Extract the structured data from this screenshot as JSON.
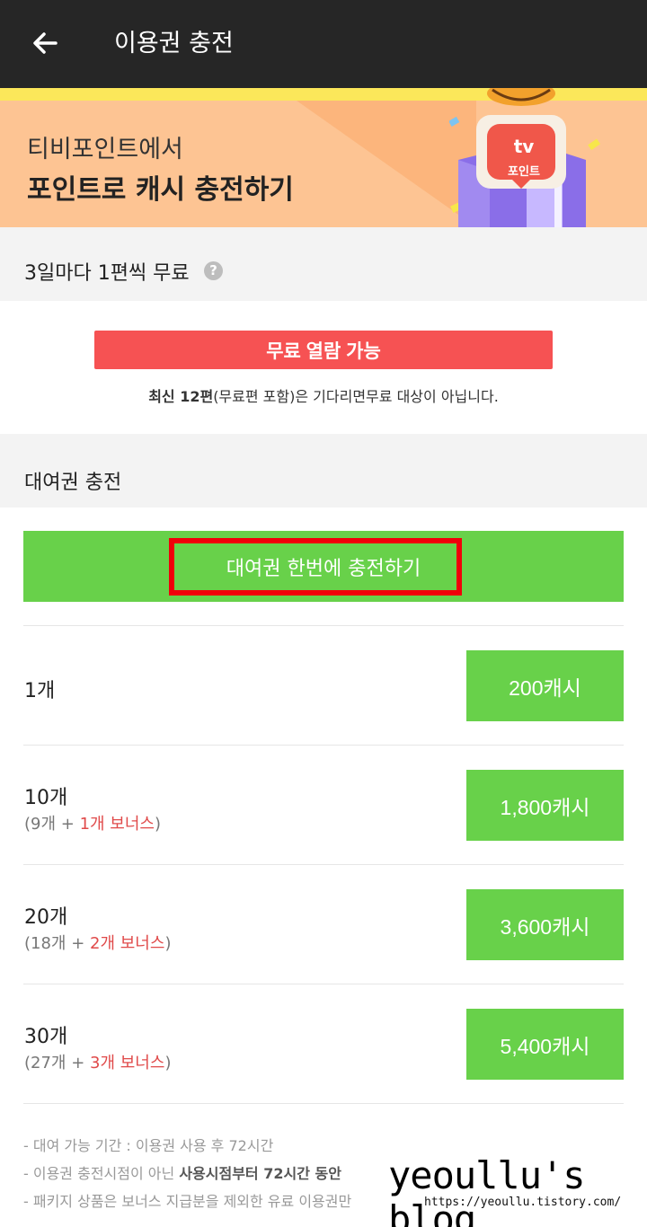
{
  "header": {
    "title": "이용권 충전",
    "back_icon": "arrow-left-icon"
  },
  "banner": {
    "subtitle": "티비포인트에서",
    "title": "포인트로 캐시 충전하기",
    "badge_tv": "tv",
    "badge_label": "포인트"
  },
  "free_section": {
    "title": "3일마다 1편씩 무료",
    "help_icon": "?",
    "button_label": "무료 열람 가능",
    "note_bold": "최신 12편",
    "note_rest": "(무료편 포함)은 기다리면무료 대상이 아닙니다."
  },
  "rental_section": {
    "title": "대여권 충전",
    "charge_all_label": "대여권 한번에 충전하기"
  },
  "packages": [
    {
      "qty": "1개",
      "detail_prefix": "",
      "bonus": "",
      "detail_suffix": "",
      "price": "200캐시"
    },
    {
      "qty": "10개",
      "detail_prefix": "(9개 + ",
      "bonus": "1개 보너스",
      "detail_suffix": ")",
      "price": "1,800캐시"
    },
    {
      "qty": "20개",
      "detail_prefix": "(18개 + ",
      "bonus": "2개 보너스",
      "detail_suffix": ")",
      "price": "3,600캐시"
    },
    {
      "qty": "30개",
      "detail_prefix": "(27개 + ",
      "bonus": "3개 보너스",
      "detail_suffix": ")",
      "price": "5,400캐시"
    }
  ],
  "notes": {
    "line1": "- 대여 가능 기간 : 이용권 사용 후 72시간",
    "line2_prefix": "- 이용권 충전시점이 아닌 ",
    "line2_bold": "사용시점부터 72시간 동안",
    "line3": "- 패키지 상품은 보너스 지급분을 제외한 유료 이용권만"
  },
  "watermark": {
    "text": "yeoullu's blog",
    "url": "https://yeoullu.tistory.com/"
  },
  "colors": {
    "topbar": "#262626",
    "banner": "#fdc493",
    "green": "#68d14a",
    "red_button": "#f65253",
    "highlight": "#f0000a",
    "bonus": "#e04a4a"
  }
}
